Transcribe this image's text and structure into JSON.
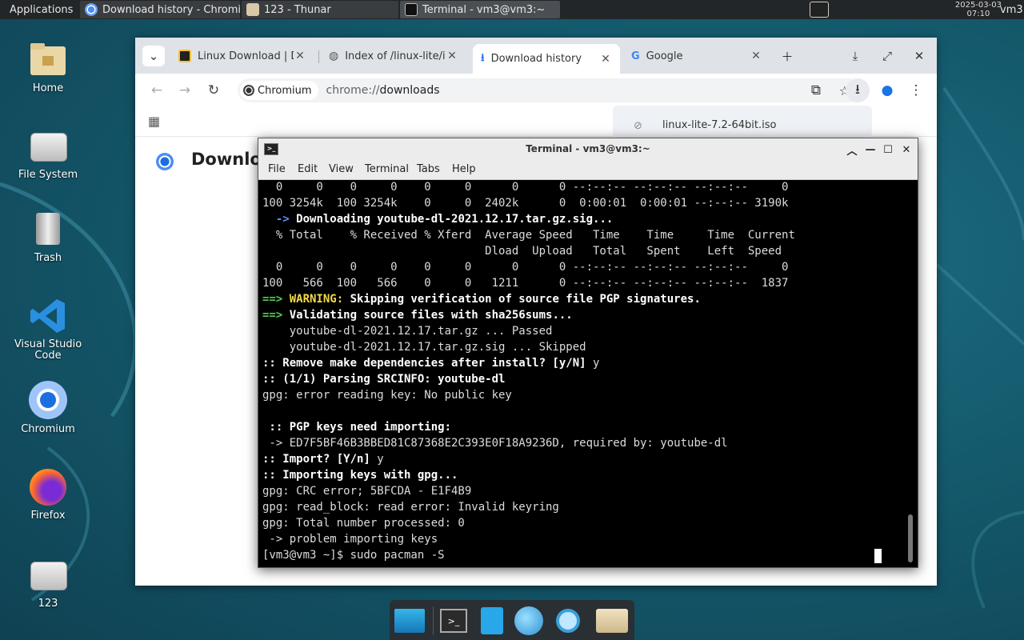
{
  "top_panel": {
    "applications_label": "Applications",
    "tasks": [
      {
        "label": "Download history - Chromi…",
        "icon": "chromium-icon"
      },
      {
        "label": "123 - Thunar",
        "icon": "folder-icon"
      },
      {
        "label": "Terminal - vm3@vm3:~",
        "icon": "terminal-icon"
      }
    ],
    "clock_date": "2025-03-03",
    "clock_time": "07:10",
    "user": "vm3"
  },
  "desktop_icons": [
    {
      "label": "Home",
      "icon": "home-folder-icon"
    },
    {
      "label": "File System",
      "icon": "drive-icon"
    },
    {
      "label": "Trash",
      "icon": "trash-icon"
    },
    {
      "label": "Visual Studio Code",
      "icon": "vscode-icon"
    },
    {
      "label": "Chromium",
      "icon": "chromium-icon"
    },
    {
      "label": "Firefox",
      "icon": "firefox-icon"
    },
    {
      "label": "123",
      "icon": "drive-icon"
    }
  ],
  "browser": {
    "tabs": [
      {
        "title": "Linux Download | De",
        "icon": "linux-lite-icon"
      },
      {
        "title": "Index of /linux-lite/is",
        "icon": "globe-icon"
      },
      {
        "title": "Download history",
        "icon": "download-icon"
      },
      {
        "title": "Google",
        "icon": "google-icon"
      }
    ],
    "site_chip": "Chromium",
    "url_scheme": "chrome://",
    "url_path": "downloads",
    "page_heading": "Downloa",
    "download_bubble_file": "linux-lite-7.2-64bit.iso"
  },
  "terminal": {
    "title": "Terminal - vm3@vm3:~",
    "menu": [
      "File",
      "Edit",
      "View",
      "Terminal",
      "Tabs",
      "Help"
    ],
    "lines": [
      [
        {
          "t": "  0     0    0     0    0     0      0      0 --:--:-- --:--:-- --:--:--     0",
          "c": ""
        }
      ],
      [
        {
          "t": "100 3254k  100 3254k    0     0  2402k      0  0:00:01  0:00:01 --:--:-- 3190k",
          "c": ""
        }
      ],
      [
        {
          "t": "  -> ",
          "c": "bl"
        },
        {
          "t": "Downloading youtube-dl-2021.12.17.tar.gz.sig...",
          "c": "b"
        }
      ],
      [
        {
          "t": "  % Total    % Received % Xferd  Average Speed   Time    Time     Time  Current",
          "c": ""
        }
      ],
      [
        {
          "t": "                                 Dload  Upload   Total   Spent    Left  Speed",
          "c": ""
        }
      ],
      [
        {
          "t": "  0     0    0     0    0     0      0      0 --:--:-- --:--:-- --:--:--     0",
          "c": ""
        }
      ],
      [
        {
          "t": "100   566  100   566    0     0   1211      0 --:--:-- --:--:-- --:--:--  1837",
          "c": ""
        }
      ],
      [
        {
          "t": "==> ",
          "c": "g"
        },
        {
          "t": "WARNING: ",
          "c": "y"
        },
        {
          "t": "Skipping verification of source file PGP signatures.",
          "c": "b"
        }
      ],
      [
        {
          "t": "==> ",
          "c": "g"
        },
        {
          "t": "Validating source files with sha256sums...",
          "c": "b"
        }
      ],
      [
        {
          "t": "    youtube-dl-2021.12.17.tar.gz ... Passed",
          "c": ""
        }
      ],
      [
        {
          "t": "    youtube-dl-2021.12.17.tar.gz.sig ... Skipped",
          "c": ""
        }
      ],
      [
        {
          "t": ":: Remove make dependencies after install? [y/N]",
          "c": "b"
        },
        {
          "t": " y",
          "c": ""
        }
      ],
      [
        {
          "t": ":: (1/1) Parsing SRCINFO: youtube-dl",
          "c": "b"
        }
      ],
      [
        {
          "t": "gpg: error reading key: No public key",
          "c": ""
        }
      ],
      [
        {
          "t": "",
          "c": ""
        }
      ],
      [
        {
          "t": " :: PGP keys need importing:",
          "c": "b"
        }
      ],
      [
        {
          "t": " -> ED7F5BF46B3BBED81C87368E2C393E0F18A9236D, required by: youtube-dl",
          "c": ""
        }
      ],
      [
        {
          "t": ":: Import? [Y/n]",
          "c": "b"
        },
        {
          "t": " y",
          "c": ""
        }
      ],
      [
        {
          "t": ":: Importing keys with gpg...",
          "c": "b"
        }
      ],
      [
        {
          "t": "gpg: CRC error; 5BFCDA - E1F4B9",
          "c": ""
        }
      ],
      [
        {
          "t": "gpg: read_block: read error: Invalid keyring",
          "c": ""
        }
      ],
      [
        {
          "t": "gpg: Total number processed: 0",
          "c": ""
        }
      ],
      [
        {
          "t": " -> problem importing keys",
          "c": ""
        }
      ],
      [
        {
          "t": "[vm3@vm3 ~]$ sudo pacman -S",
          "c": ""
        }
      ]
    ]
  },
  "dock": [
    "desktop-icon",
    "terminal-icon",
    "file-manager-icon",
    "browser-icon",
    "search-icon",
    "folder-icon"
  ]
}
